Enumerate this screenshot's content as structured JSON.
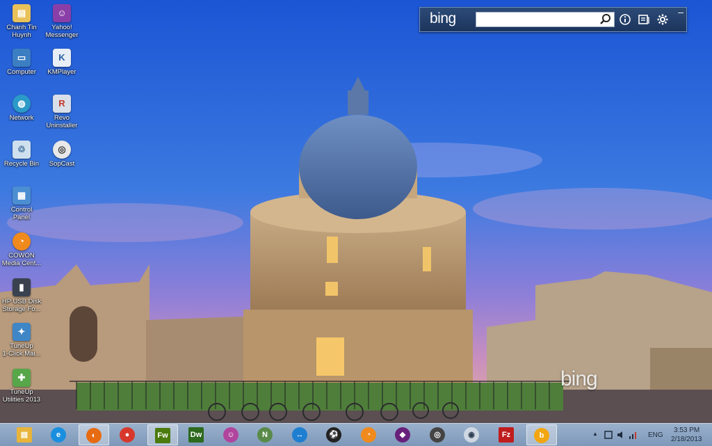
{
  "desktop": {
    "icons": [
      {
        "label": "Chanh Tin\nHuynh",
        "icon": "user-folder-icon"
      },
      {
        "label": "Yahoo!\nMessenger",
        "icon": "yahoo-messenger-icon"
      },
      {
        "label": "Computer",
        "icon": "computer-icon"
      },
      {
        "label": "KMPlayer",
        "icon": "kmplayer-icon"
      },
      {
        "label": "Network",
        "icon": "network-icon"
      },
      {
        "label": "Revo\nUninstaller",
        "icon": "revo-uninstaller-icon"
      },
      {
        "label": "Recycle Bin",
        "icon": "recycle-bin-icon"
      },
      {
        "label": "SopCast",
        "icon": "sopcast-icon"
      },
      {
        "label": "Control\nPanel",
        "icon": "control-panel-icon"
      },
      {
        "label": "COWON\nMedia Cent...",
        "icon": "cowon-media-center-icon"
      },
      {
        "label": "HP USB Disk\nStorage Fo...",
        "icon": "hp-usb-disk-icon"
      },
      {
        "label": "TuneUp\n1-Click Mai...",
        "icon": "tuneup-1click-icon"
      },
      {
        "label": "TuneUp\nUtilities 2013",
        "icon": "tuneup-utilities-icon"
      }
    ]
  },
  "bingbar": {
    "logo": "bing",
    "search_value": "",
    "search_icon": "magnifier-icon",
    "info_icon": "info-icon",
    "news_icon": "news-icon",
    "settings_icon": "gear-icon",
    "minimize": "–"
  },
  "wallpaper": {
    "watermark": "bing"
  },
  "taskbar": {
    "apps": [
      {
        "name": "file-explorer",
        "icon": "folder-icon",
        "color": "#e8b43a",
        "glyph": "▤"
      },
      {
        "name": "internet-explorer",
        "icon": "internet-explorer-icon",
        "color": "#1a8fe0",
        "glyph": "e"
      },
      {
        "name": "firefox",
        "icon": "firefox-icon",
        "color": "#e66b12",
        "glyph": "◐"
      },
      {
        "name": "chrome",
        "icon": "chrome-icon",
        "color": "#d8382c",
        "glyph": "●"
      },
      {
        "name": "fireworks",
        "icon": "fireworks-icon",
        "color": "#4a7b0c",
        "glyph": "Fw"
      },
      {
        "name": "dreamweaver",
        "icon": "dreamweaver-icon",
        "color": "#2d6a1d",
        "glyph": "Dw"
      },
      {
        "name": "yahoo-messenger",
        "icon": "yahoo-messenger-icon",
        "color": "#b0459d",
        "glyph": "☺"
      },
      {
        "name": "notepadpp",
        "icon": "notepad-plus-plus-icon",
        "color": "#5a8a4a",
        "glyph": "N"
      },
      {
        "name": "teamviewer",
        "icon": "teamviewer-icon",
        "color": "#1e7fd0",
        "glyph": "↔"
      },
      {
        "name": "media-player",
        "icon": "soccer-ball-icon",
        "color": "#222222",
        "glyph": "⚽"
      },
      {
        "name": "cowon",
        "icon": "cowon-icon",
        "color": "#f08a1c",
        "glyph": "◔"
      },
      {
        "name": "visual-studio",
        "icon": "visual-studio-icon",
        "color": "#68217a",
        "glyph": "◆"
      },
      {
        "name": "sopcast",
        "icon": "sopcast-icon",
        "color": "#444444",
        "glyph": "◎"
      },
      {
        "name": "wifi",
        "icon": "wireless-icon",
        "color": "#cfd8e2",
        "glyph": "◉"
      },
      {
        "name": "filezilla",
        "icon": "filezilla-icon",
        "color": "#bf1d1d",
        "glyph": "Fz"
      },
      {
        "name": "bing-desktop",
        "icon": "bing-icon",
        "color": "#f2a612",
        "glyph": "b"
      }
    ],
    "tray": {
      "show_hidden_icon": "▲",
      "language": "ENG",
      "time": "3:53 PM",
      "date": "2/18/2013"
    }
  },
  "colors": {
    "taskbar": "#8aa4c3",
    "bingbar": "#23406b",
    "sky": "#2b63c9"
  }
}
